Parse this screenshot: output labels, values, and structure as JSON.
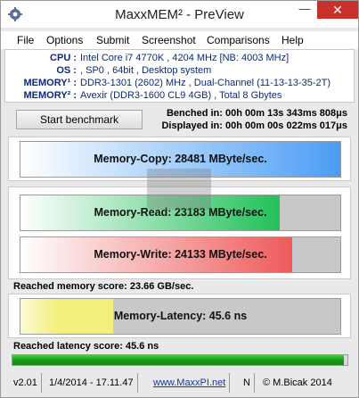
{
  "window": {
    "title": "MaxxMEM² - PreView"
  },
  "titlebar": {
    "minimize": "—",
    "close": "✕",
    "app_icon": "gear-icon"
  },
  "menu": [
    "File",
    "Options",
    "Submit",
    "Screenshot",
    "Comparisons",
    "Help"
  ],
  "sysinfo": [
    {
      "label": "CPU :",
      "value": "Intel Core i7 4770K , 4204 MHz  [NB: 4003 MHz]"
    },
    {
      "label": "OS :",
      "value": ", SP0 , 64bit , Desktop system"
    },
    {
      "label": "MEMORY¹ :",
      "value": "DDR3-1301 (2602) MHz , Dual-Channel (11-13-13-35-2T)"
    },
    {
      "label": "MEMORY² :",
      "value": "Avexir (DDR3-1600 CL9 4GB) , Total 8 Gbytes"
    }
  ],
  "benchmark": {
    "start_label": "Start benchmark",
    "benched_in": "Benched in: 00h 00m 13s 343ms 808μs",
    "displayed_in": "Displayed in: 00h 00m 00s 022ms 017μs"
  },
  "bars": {
    "copy": {
      "label": "Memory-Copy: 28481 MByte/sec.",
      "fraction": 1.0,
      "color": "#4a9df5"
    },
    "read": {
      "label": "Memory-Read: 23183 MByte/sec.",
      "fraction": 0.81,
      "color": "#22c05a"
    },
    "write": {
      "label": "Memory-Write: 24133 MByte/sec.",
      "fraction": 0.85,
      "color": "#ee5a5a"
    },
    "latency": {
      "label": "Memory-Latency: 45.6 ns",
      "fraction": 0.29,
      "color": "#f3ef7a"
    }
  },
  "scores": {
    "memory": "Reached memory score: 23.66 GB/sec.",
    "latency": "Reached latency score: 45.6 ns"
  },
  "latency_progress_fraction": 0.99,
  "status": {
    "version": "v2.01",
    "date": "1/4/2014 - 17.11.47",
    "link": "www.MaxxPI.net",
    "flag": "N",
    "copyright": "© M.Bicak 2014"
  }
}
